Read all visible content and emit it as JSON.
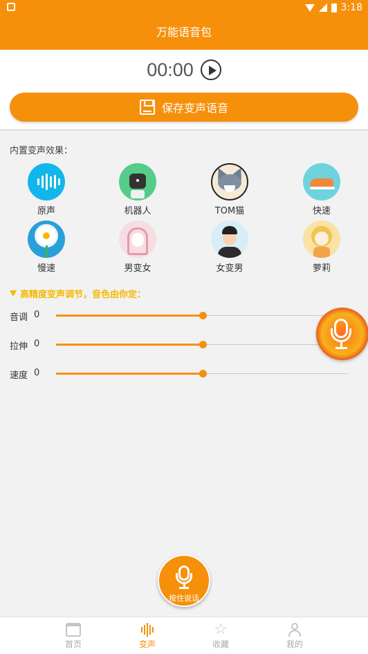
{
  "status_bar": {
    "time": "3:18"
  },
  "app_bar": {
    "title": "万能语音包"
  },
  "player": {
    "time": "00:00"
  },
  "save_button": {
    "label": "保存变声语音"
  },
  "effects_section": {
    "title": "内置变声效果："
  },
  "effects": [
    {
      "label": "原声",
      "icon": "sound-wave-icon"
    },
    {
      "label": "机器人",
      "icon": "robot-icon"
    },
    {
      "label": "TOM猫",
      "icon": "tom-cat-icon"
    },
    {
      "label": "快速",
      "icon": "sneaker-icon"
    },
    {
      "label": "慢速",
      "icon": "flower-icon"
    },
    {
      "label": "男变女",
      "icon": "girl-icon"
    },
    {
      "label": "女变男",
      "icon": "man-icon"
    },
    {
      "label": "萝莉",
      "icon": "little-girl-icon"
    }
  ],
  "adjust_section": {
    "title": "高精度变声调节，音色由你定："
  },
  "sliders": [
    {
      "label": "音调",
      "value": "0",
      "fraction": 0.5
    },
    {
      "label": "拉伸",
      "value": "0",
      "fraction": 0.5
    },
    {
      "label": "速度",
      "value": "0",
      "fraction": 0.5
    }
  ],
  "talk_button": {
    "label": "按住说话"
  },
  "bottom_nav": [
    {
      "label": "首页",
      "icon": "home-icon",
      "active": false
    },
    {
      "label": "变声",
      "icon": "voice-wave-icon",
      "active": true
    },
    {
      "label": "收藏",
      "icon": "star-icon",
      "active": false
    },
    {
      "label": "我的",
      "icon": "user-icon",
      "active": false
    }
  ],
  "colors": {
    "accent": "#f6900b",
    "highlight": "#f6b800",
    "background": "#f2f2f2"
  }
}
